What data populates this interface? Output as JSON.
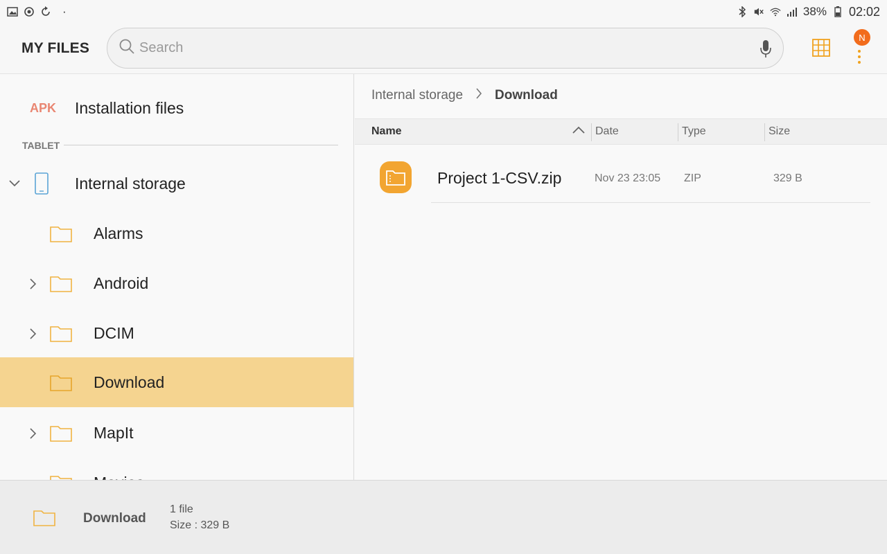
{
  "status_bar": {
    "battery": "38%",
    "time": "02:02",
    "dot": "·"
  },
  "app": {
    "title": "MY FILES",
    "badge": "N"
  },
  "search": {
    "placeholder": "Search"
  },
  "sidebar": {
    "apk_tag": "APK",
    "installation_label": "Installation files",
    "section": "TABLET",
    "storage_label": "Internal storage",
    "folders": [
      {
        "label": "Alarms"
      },
      {
        "label": "Android"
      },
      {
        "label": "DCIM"
      },
      {
        "label": "Download"
      },
      {
        "label": "MapIt"
      },
      {
        "label": "Movies"
      }
    ]
  },
  "main": {
    "breadcrumb": [
      "Internal storage",
      "Download"
    ],
    "columns": [
      "Name",
      "Date",
      "Type",
      "Size"
    ],
    "files": [
      {
        "name": "Project 1-CSV.zip",
        "date": "Nov 23 23:05",
        "type": "ZIP",
        "size": "329 B"
      }
    ]
  },
  "footer": {
    "folder": "Download",
    "count": "1 file",
    "size": "Size : 329 B"
  },
  "colors": {
    "accent": "#f2a531",
    "selected_row": "#f5d490",
    "badge": "#f26c1c",
    "apk": "#e98672"
  }
}
